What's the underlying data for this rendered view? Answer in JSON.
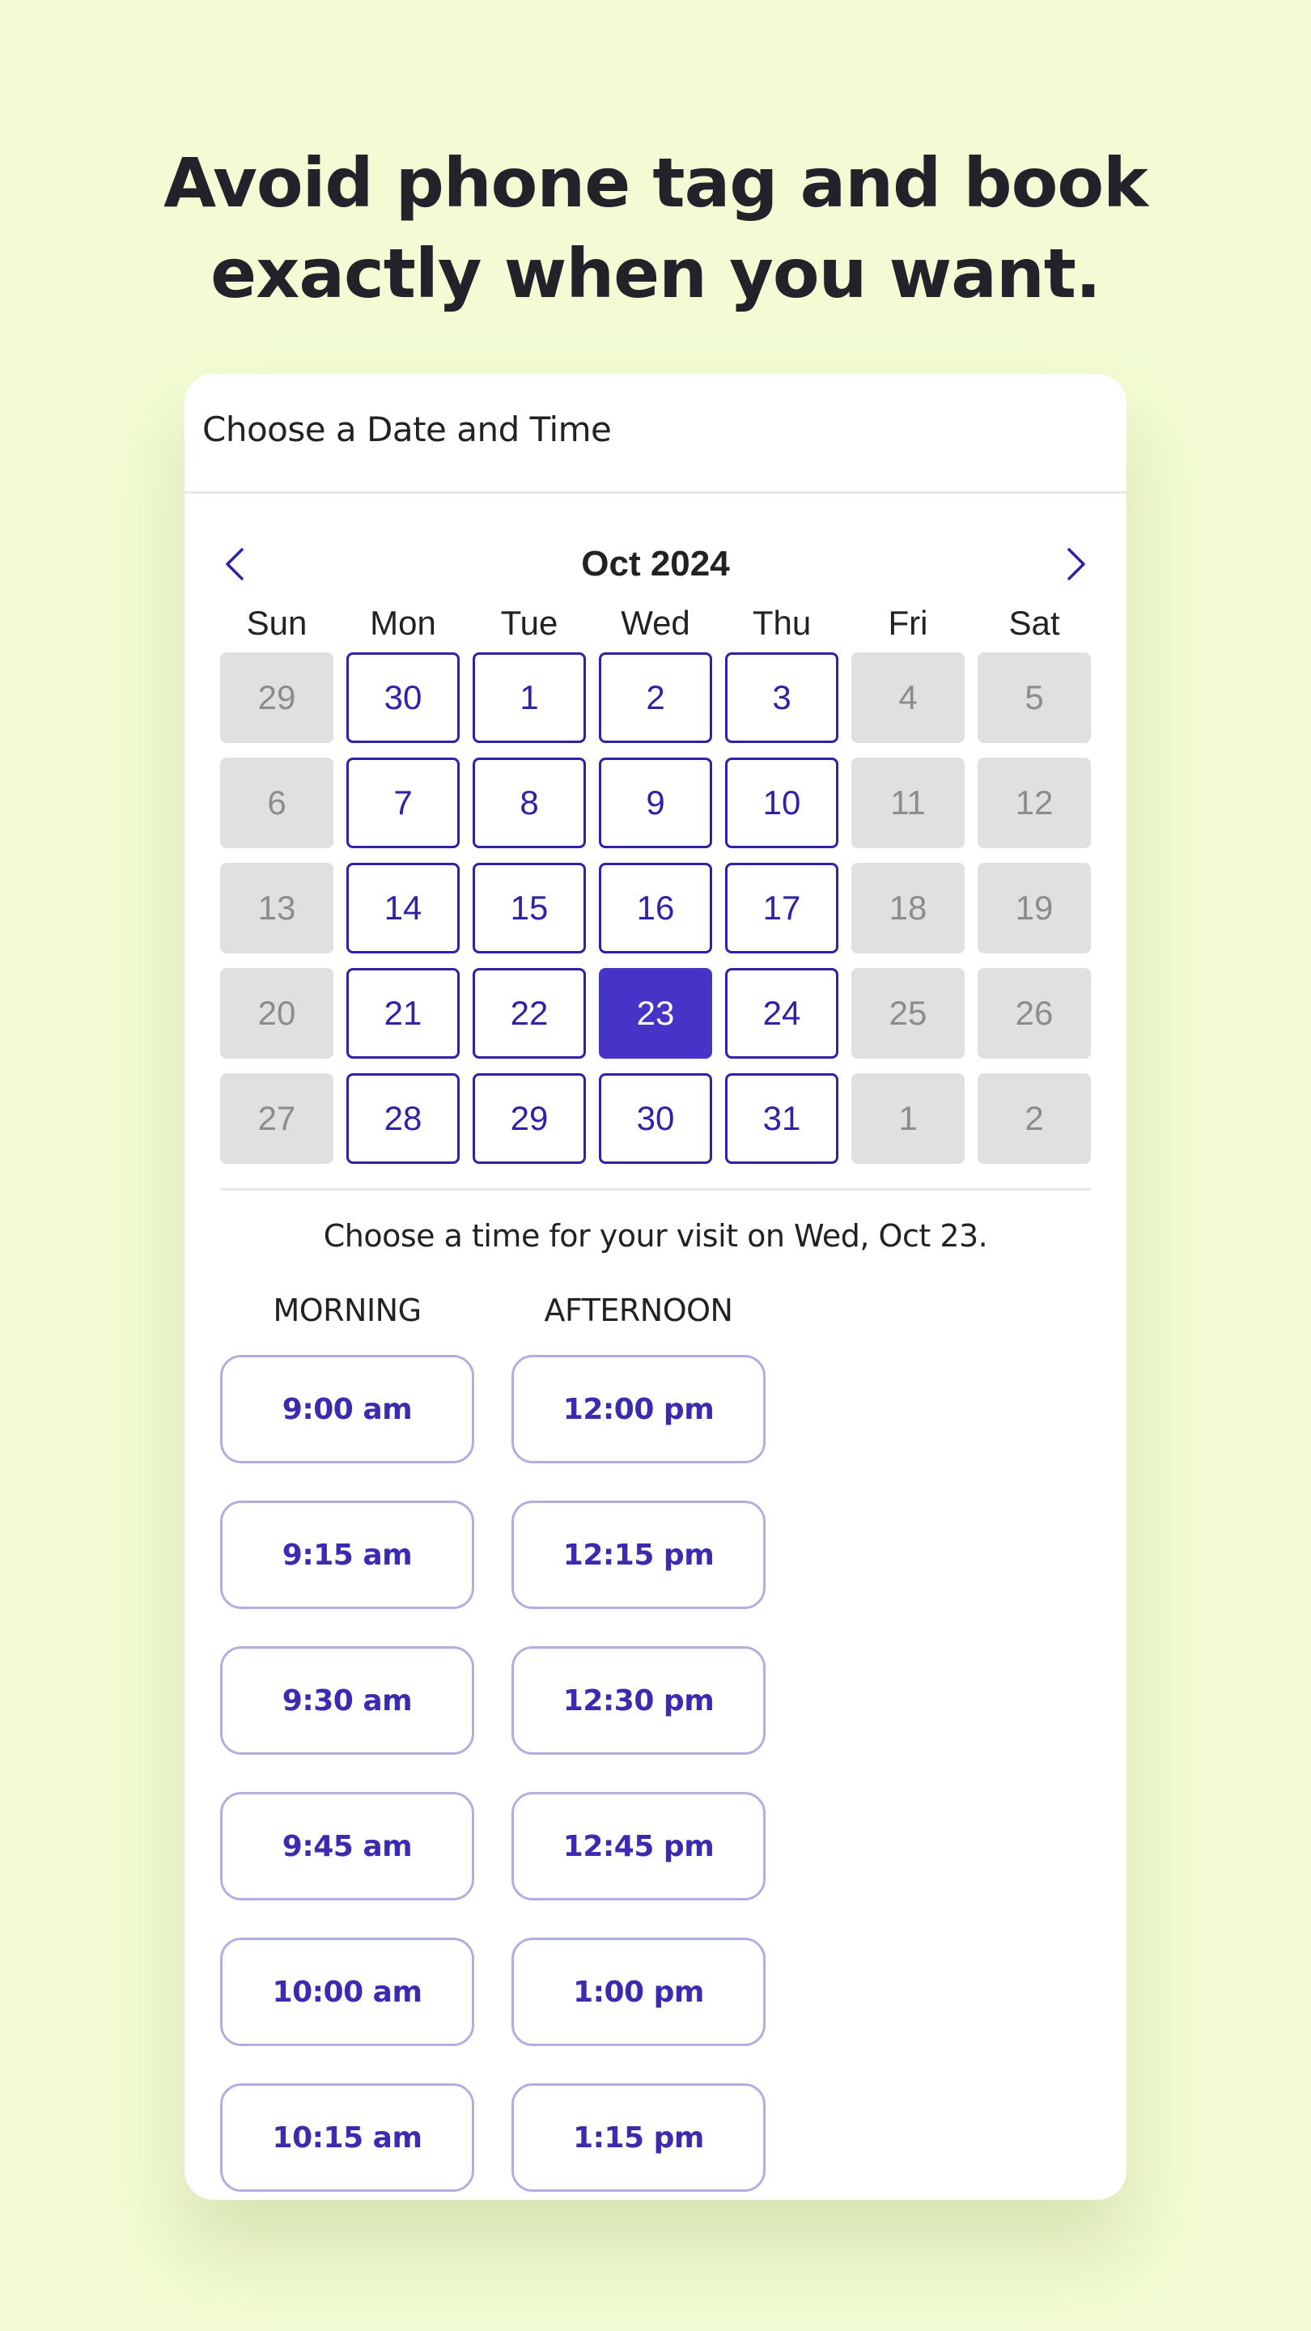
{
  "headline": {
    "line1": "Avoid phone tag and book",
    "line2": "exactly when you want."
  },
  "card": {
    "title": "Choose a Date and Time"
  },
  "calendar": {
    "month_label": "Oct 2024",
    "prev_icon": "chevron-left-icon",
    "next_icon": "chevron-right-icon",
    "weekdays": [
      "Sun",
      "Mon",
      "Tue",
      "Wed",
      "Thu",
      "Fri",
      "Sat"
    ],
    "selected": "23",
    "weeks": [
      [
        {
          "d": "29",
          "s": "unavailable"
        },
        {
          "d": "30",
          "s": "available"
        },
        {
          "d": "1",
          "s": "available"
        },
        {
          "d": "2",
          "s": "available"
        },
        {
          "d": "3",
          "s": "available"
        },
        {
          "d": "4",
          "s": "unavailable"
        },
        {
          "d": "5",
          "s": "unavailable"
        }
      ],
      [
        {
          "d": "6",
          "s": "unavailable"
        },
        {
          "d": "7",
          "s": "available"
        },
        {
          "d": "8",
          "s": "available"
        },
        {
          "d": "9",
          "s": "available"
        },
        {
          "d": "10",
          "s": "available"
        },
        {
          "d": "11",
          "s": "unavailable"
        },
        {
          "d": "12",
          "s": "unavailable"
        }
      ],
      [
        {
          "d": "13",
          "s": "unavailable"
        },
        {
          "d": "14",
          "s": "available"
        },
        {
          "d": "15",
          "s": "available"
        },
        {
          "d": "16",
          "s": "available"
        },
        {
          "d": "17",
          "s": "available"
        },
        {
          "d": "18",
          "s": "unavailable"
        },
        {
          "d": "19",
          "s": "unavailable"
        }
      ],
      [
        {
          "d": "20",
          "s": "unavailable"
        },
        {
          "d": "21",
          "s": "available"
        },
        {
          "d": "22",
          "s": "available"
        },
        {
          "d": "23",
          "s": "selected"
        },
        {
          "d": "24",
          "s": "available"
        },
        {
          "d": "25",
          "s": "unavailable"
        },
        {
          "d": "26",
          "s": "unavailable"
        }
      ],
      [
        {
          "d": "27",
          "s": "unavailable"
        },
        {
          "d": "28",
          "s": "available"
        },
        {
          "d": "29",
          "s": "available"
        },
        {
          "d": "30",
          "s": "available"
        },
        {
          "d": "31",
          "s": "available"
        },
        {
          "d": "1",
          "s": "unavailable"
        },
        {
          "d": "2",
          "s": "unavailable"
        }
      ]
    ]
  },
  "times": {
    "prompt": "Choose a time for your visit on Wed, Oct 23.",
    "morning_label": "MORNING",
    "afternoon_label": "AFTERNOON",
    "morning": [
      "9:00 am",
      "9:15 am",
      "9:30 am",
      "9:45 am",
      "10:00 am",
      "10:15 am"
    ],
    "afternoon": [
      "12:00 pm",
      "12:15 pm",
      "12:30 pm",
      "12:45 pm",
      "1:00 pm",
      "1:15 pm"
    ]
  },
  "colors": {
    "background": "#f2fbd3",
    "accent": "#4634c9",
    "accent_text": "#2d22a8",
    "unavailable_bg": "#e0e0e0",
    "unavailable_text": "#8c8c8c"
  }
}
